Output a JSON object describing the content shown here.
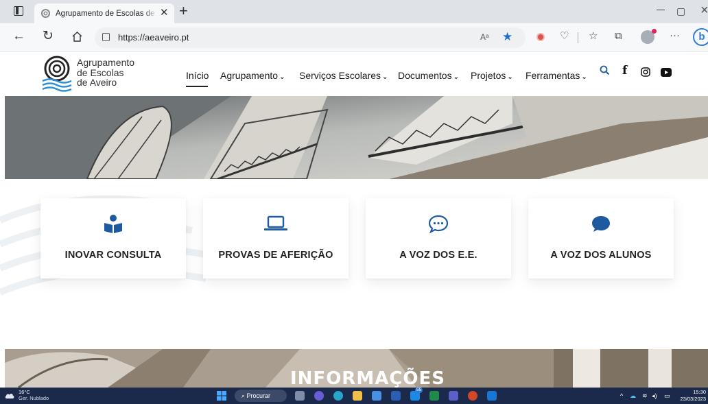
{
  "browser": {
    "tab_title": "Agrupamento de Escolas de Aveiro",
    "url": "https://aeaveiro.pt",
    "read_aloud": "Aᵃ",
    "icons": [
      "tab-actions-icon",
      "site-favicon",
      "close-icon",
      "new-tab-icon",
      "minimize-icon",
      "maximize-icon",
      "window-close-icon",
      "back-icon",
      "refresh-icon",
      "home-icon",
      "info-icon",
      "read-aloud-icon",
      "favorite-star-icon",
      "extension-icon",
      "browser-essentials-icon",
      "favorites-icon",
      "collections-icon",
      "profile-icon",
      "more-icon",
      "bing-icon"
    ]
  },
  "site": {
    "logo_lines": [
      "Agrupamento",
      "de Escolas",
      "de Aveiro"
    ],
    "nav": [
      {
        "label": "Início",
        "dropdown": false,
        "active": true
      },
      {
        "label": "Agrupamento",
        "dropdown": true
      },
      {
        "label": "Serviços Escolares",
        "dropdown": true
      },
      {
        "label": "Documentos",
        "dropdown": true
      },
      {
        "label": "Projetos",
        "dropdown": true
      },
      {
        "label": "Ferramentas",
        "dropdown": true
      }
    ],
    "header_icons": [
      "search-icon",
      "facebook-icon",
      "instagram-icon",
      "youtube-icon"
    ],
    "accent_color": "#1d5aa0",
    "cards": [
      {
        "label": "INOVAR CONSULTA",
        "icon": "book-reader-icon"
      },
      {
        "label": "PROVAS DE AFERIÇÃO",
        "icon": "laptop-icon"
      },
      {
        "label": "A VOZ DOS E.E.",
        "icon": "chat-dots-icon"
      },
      {
        "label": "A VOZ DOS ALUNOS",
        "icon": "chat-bubble-icon"
      }
    ],
    "section_title": "INFORMAÇÕES"
  },
  "taskbar": {
    "weather_temp": "16°C",
    "weather_condition": "Ger. Nublado",
    "search_label": "Procurar",
    "time": "15:30",
    "date": "23/03/2023",
    "apps": [
      "windows-start-icon",
      "task-view-icon",
      "chat-icon",
      "edge-icon",
      "file-explorer-icon",
      "store-icon",
      "word-icon",
      "mail-icon",
      "excel-icon",
      "teams-icon",
      "powerpoint-icon",
      "outlook-icon"
    ],
    "mail_badge": "55"
  }
}
